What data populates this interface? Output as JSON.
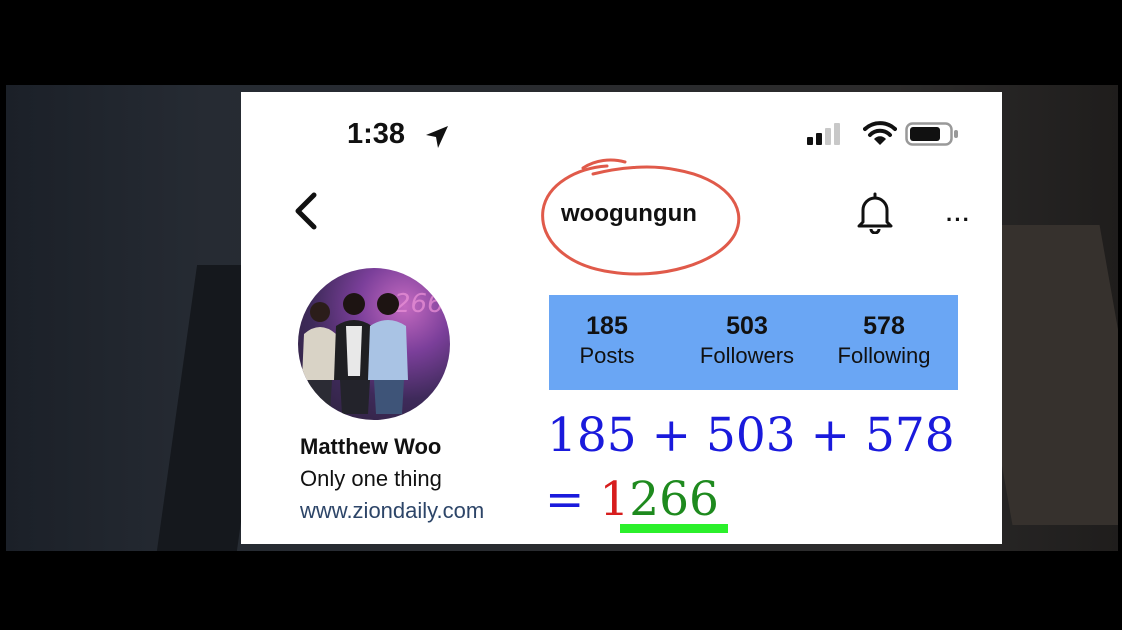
{
  "status_bar": {
    "time": "1:38",
    "location_icon": "location-arrow-icon",
    "signal_icon": "cellular-signal-icon",
    "wifi_icon": "wifi-icon",
    "battery_icon": "battery-icon"
  },
  "header": {
    "username": "woogungun",
    "back_icon": "chevron-left-icon",
    "bell_icon": "bell-icon",
    "more_label": "···"
  },
  "profile": {
    "name": "Matthew Woo",
    "bio": "Only one thing",
    "website": "www.ziondaily.com"
  },
  "stats": [
    {
      "number": "185",
      "label": "Posts"
    },
    {
      "number": "503",
      "label": "Followers"
    },
    {
      "number": "578",
      "label": "Following"
    }
  ],
  "annotation": {
    "equation": "185 + 503 + 578",
    "result_prefix": "= ",
    "result_first_digit": "1",
    "result_rest": "266",
    "colors": {
      "equation": "#1a1adc",
      "first_digit": "#d71d1d",
      "rest": "#1e8a1e",
      "underline": "#2bf02b",
      "circle": "#e05a4a",
      "stats_box": "#6aa6f4"
    }
  }
}
